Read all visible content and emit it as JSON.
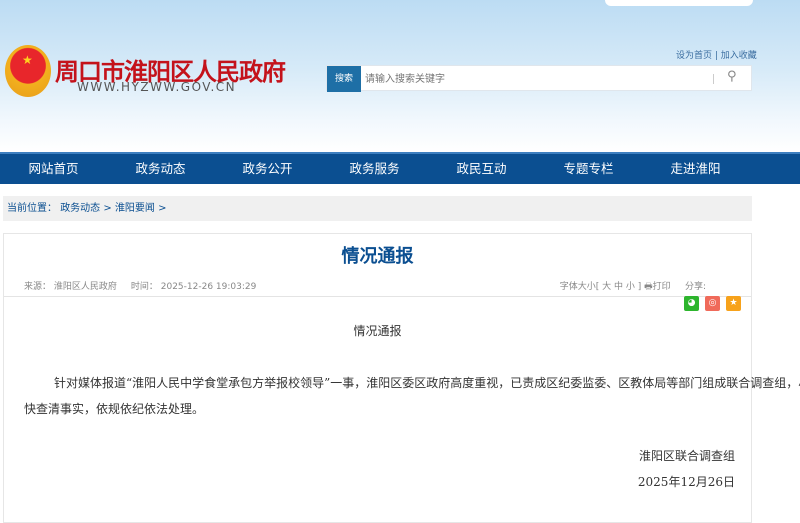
{
  "header": {
    "title": "周口市淮阳区人民政府",
    "url": "WWW.HYZWW.GOV.CN",
    "links": [
      "设为首页",
      "加入收藏"
    ],
    "search_label": "搜索",
    "search_placeholder": "请输入搜索关键字"
  },
  "nav": [
    "网站首页",
    "政务动态",
    "政务公开",
    "政务服务",
    "政民互动",
    "专题专栏",
    "走进淮阳"
  ],
  "breadcrumb": {
    "label": "当前位置：",
    "items": [
      "政务动态 >",
      "淮阳要闻 >"
    ]
  },
  "article": {
    "title": "情况通报",
    "source": "来源：  淮阳区人民政府",
    "time": "时间：  2025-12-26 19:03:29",
    "font_size": "字体大小[ 大  中  小 ]",
    "print": "打印",
    "share": "分享:",
    "subtitle": "情况通报",
    "body": "针对媒体报道“淮阳人民中学食堂承包方举报校领导”一事，淮阳区委区政府高度重视，已责成区纪委监委、区教体局等部门组成联合调查组，尽快查清事实，依规依纪依法处理。",
    "signer": "淮阳区联合调查组",
    "date": "2025年12月26日"
  },
  "colors": {
    "nav": "#0b4f91",
    "title": "#c4121b",
    "wechat": "#2db52d",
    "weibo": "#f06a5a",
    "favorite": "#f7a21b"
  }
}
